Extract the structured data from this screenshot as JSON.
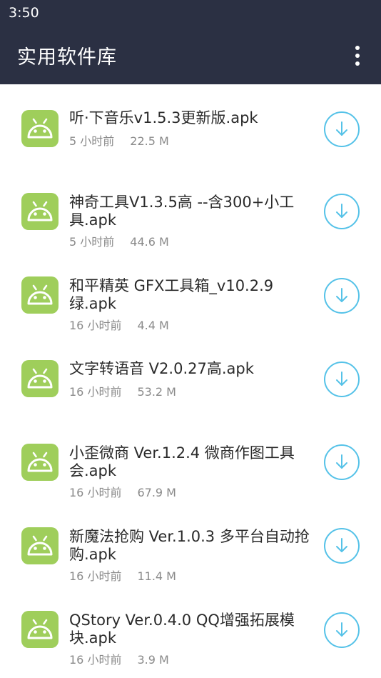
{
  "status_bar": {
    "time": "3:50"
  },
  "app_bar": {
    "title": "实用软件库",
    "menu_icon": "more-vertical-icon"
  },
  "colors": {
    "app_bar": "#2b3043",
    "android_icon_bg": "#9fce5b",
    "download_accent": "#55c2e8"
  },
  "files": [
    {
      "name": "听·下音乐v1.5.3更新版.apk",
      "time": "5 小时前",
      "size": "22.5 M",
      "icon": "android-icon",
      "action_icon": "download-icon"
    },
    {
      "name": "神奇工具V1.3.5高 --含300+小工具.apk",
      "time": "5 小时前",
      "size": "44.6 M",
      "icon": "android-icon",
      "action_icon": "download-icon"
    },
    {
      "name": "和平精英 GFX工具箱_v10.2.9绿.apk",
      "time": "16 小时前",
      "size": "4.4 M",
      "icon": "android-icon",
      "action_icon": "download-icon"
    },
    {
      "name": "文字转语音 V2.0.27高.apk",
      "time": "16 小时前",
      "size": "53.2 M",
      "icon": "android-icon",
      "action_icon": "download-icon"
    },
    {
      "name": "小歪微商 Ver.1.2.4 微商作图工具会.apk",
      "time": "16 小时前",
      "size": "67.9 M",
      "icon": "android-icon",
      "action_icon": "download-icon"
    },
    {
      "name": "新魔法抢购 Ver.1.0.3 多平台自动抢购.apk",
      "time": "16 小时前",
      "size": "11.4 M",
      "icon": "android-icon",
      "action_icon": "download-icon"
    },
    {
      "name": "QStory Ver.0.4.0 QQ增强拓展模块.apk",
      "time": "16 小时前",
      "size": "3.9 M",
      "icon": "android-icon",
      "action_icon": "download-icon"
    }
  ]
}
